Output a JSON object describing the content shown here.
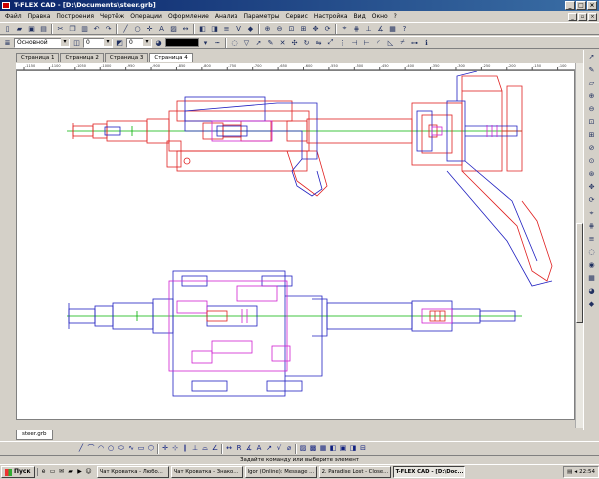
{
  "window": {
    "title": "T-FLEX CAD - [D:\\Documents\\steer.grb]"
  },
  "menu": [
    "Файл",
    "Правка",
    "Построения",
    "Чертёж",
    "Операции",
    "Оформление",
    "Анализ",
    "Параметры",
    "Сервис",
    "Настройка",
    "Вид",
    "Окно",
    "?"
  ],
  "toolbar2": {
    "layer_value": "Основной",
    "level_value": "0",
    "width_value": "0"
  },
  "page_tabs": [
    "Страница 1",
    "Страница 2",
    "Страница 3",
    "Страница 4"
  ],
  "ruler_ticks": [
    "-1150",
    "-1100",
    "-1050",
    "-1000",
    "-950",
    "-900",
    "-850",
    "-800",
    "-750",
    "-700",
    "-650",
    "-600",
    "-550",
    "-500",
    "-450",
    "-400",
    "-350",
    "-300",
    "-250",
    "-200",
    "-150",
    "-100"
  ],
  "doc_tab": "steer.grb",
  "status_text": "Задайте команду или выберите элемент",
  "taskbar": {
    "start": "Пуск",
    "items": [
      {
        "label": "Чат Кроватка - Любо...",
        "active": false
      },
      {
        "label": "Чат Кроватка - Знако...",
        "active": false
      },
      {
        "label": "Igor (Online): Message ...",
        "active": false
      },
      {
        "label": "2. Paradise Lost - Close...",
        "active": false
      },
      {
        "label": "T-FLEX CAD - [D:\\Doc...",
        "active": true
      }
    ],
    "clock": "22:54"
  },
  "colors": {
    "red": "#e02020",
    "blue": "#2020c0",
    "green": "#00b000",
    "magenta": "#d020d0"
  }
}
